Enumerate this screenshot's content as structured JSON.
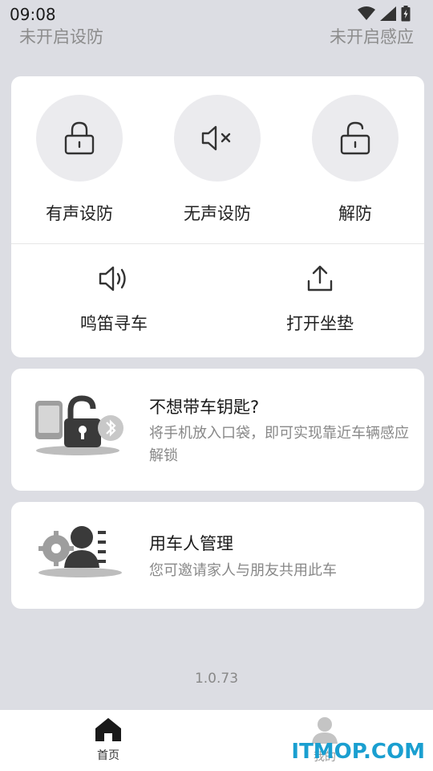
{
  "status_bar": {
    "time": "09:08"
  },
  "status_row": {
    "left": "未开启设防",
    "right": "未开启感应"
  },
  "controls": {
    "sound_arm": "有声设防",
    "silent_arm": "无声设防",
    "disarm": "解防",
    "find_car": "鸣笛寻车",
    "open_seat": "打开坐垫"
  },
  "keyless_card": {
    "title": "不想带车钥匙?",
    "desc": "将手机放入口袋，即可实现靠近车辆感应解锁"
  },
  "user_card": {
    "title": "用车人管理",
    "desc": "您可邀请家人与朋友共用此车"
  },
  "version": "1.0.73",
  "tabs": {
    "home": "首页",
    "mine": "我的"
  },
  "watermark": "ITMOP.COM",
  "colors": {
    "background": "#dcdde3",
    "card": "#ffffff",
    "circle": "#ebebee",
    "muted_text": "#888888",
    "watermark": "#1a9fd0"
  }
}
